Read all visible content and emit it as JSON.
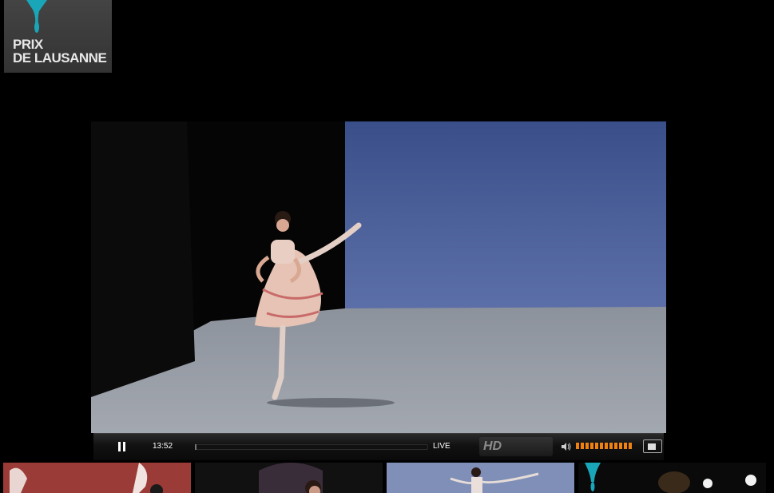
{
  "logo": {
    "line1": "PRIX",
    "line2": "DE LAUSANNE",
    "accent": "#19a6b8"
  },
  "player": {
    "pause_icon": "pause-icon",
    "time": "13:52",
    "live_label": "LIVE",
    "hd_label": "HD",
    "volume_icon": "speaker-icon",
    "volume_level": 1.0,
    "fullscreen_icon": "fullscreen-icon",
    "accent": "#f0820f"
  },
  "thumbnails": [
    {
      "name": "thumb-1"
    },
    {
      "name": "thumb-2"
    },
    {
      "name": "thumb-3"
    },
    {
      "name": "thumb-4"
    }
  ]
}
